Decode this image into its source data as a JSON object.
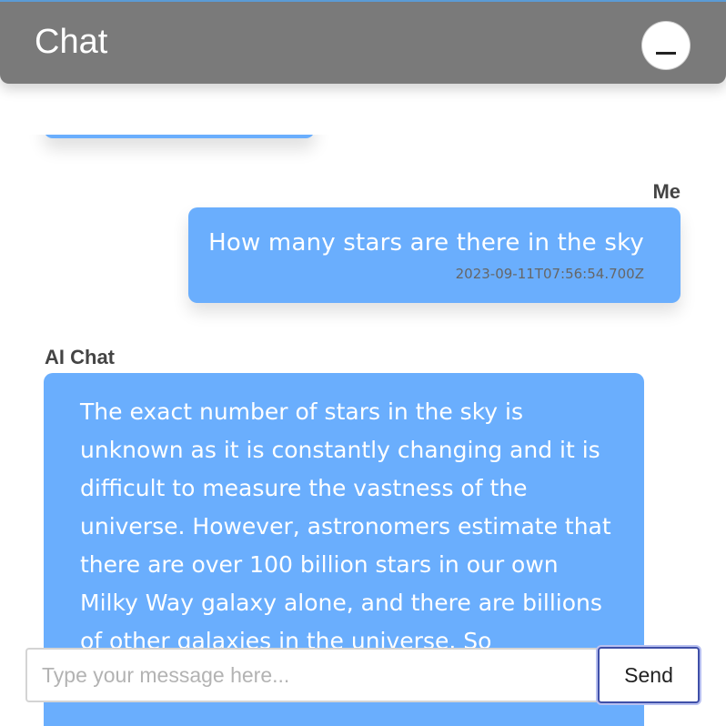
{
  "header": {
    "title": "Chat",
    "minimize_icon": "minimize-icon"
  },
  "messages": [
    {
      "sender": "Me",
      "text": "How many stars are there in the sky",
      "timestamp": "2023-09-11T07:56:54.700Z"
    },
    {
      "sender": "AI Chat",
      "text": "The exact number of stars in the sky is unknown as it is constantly changing and it is difficult to measure the vastness of the universe. However, astronomers estimate that there are over 100 billion stars in our own Milky Way galaxy alone, and there are billions of other galaxies in the universe. So"
    }
  ],
  "composer": {
    "placeholder": "Type your message here...",
    "value": "",
    "send_label": "Send"
  },
  "colors": {
    "header_bg": "#7a7a7a",
    "bubble_bg": "#6aaefd",
    "send_border": "#3f4fa8"
  }
}
